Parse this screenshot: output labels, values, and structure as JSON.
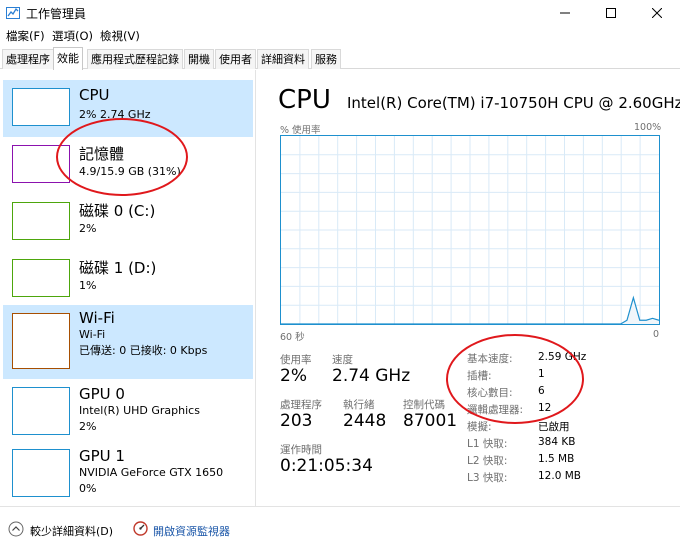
{
  "window": {
    "title": "工作管理員",
    "min_icon": "minimize-icon",
    "max_icon": "maximize-icon",
    "close_icon": "close-icon"
  },
  "menu": [
    {
      "label": "檔案(F)"
    },
    {
      "label": "選項(O)"
    },
    {
      "label": "檢視(V)"
    }
  ],
  "tabs": [
    {
      "label": "處理程序"
    },
    {
      "label": "效能",
      "active": true
    },
    {
      "label": "應用程式歷程記錄"
    },
    {
      "label": "開機"
    },
    {
      "label": "使用者"
    },
    {
      "label": "詳細資料"
    },
    {
      "label": "服務"
    }
  ],
  "sidebar": {
    "items": [
      {
        "title": "CPU",
        "sub1": "2% 2.74 GHz",
        "sub2": "",
        "color": "#1e90ce",
        "selected": true
      },
      {
        "title": "記憶體",
        "sub1": "4.9/15.9 GB (31%)",
        "sub2": "",
        "color": "#8b12ae",
        "selected": false
      },
      {
        "title": "磁碟 0 (C:)",
        "sub1": "2%",
        "sub2": "",
        "color": "#4da60c",
        "selected": false
      },
      {
        "title": "磁碟 1 (D:)",
        "sub1": "1%",
        "sub2": "",
        "color": "#4da60c",
        "selected": false
      },
      {
        "title": "Wi-Fi",
        "sub1": "Wi-Fi",
        "sub2": "已傳送: 0 已接收: 0 Kbps",
        "color": "#a74f01",
        "selected": true
      },
      {
        "title": "GPU 0",
        "sub1": "Intel(R) UHD Graphics",
        "sub2": "2%",
        "color": "#1e90ce",
        "selected": false
      },
      {
        "title": "GPU 1",
        "sub1": "NVIDIA GeForce GTX 1650",
        "sub2": "0%",
        "color": "#1e90ce",
        "selected": false
      }
    ]
  },
  "main": {
    "title": "CPU",
    "model": "Intel(R) Core(TM) i7-10750H CPU @ 2.60GHz",
    "graph": {
      "y_label": "% 使用率",
      "y_max_label": "100%",
      "x_left_label": "60 秒",
      "x_right_label": "0",
      "color": "#1e90ce",
      "usage_history_percent": [
        0,
        0,
        0,
        0,
        0,
        0,
        0,
        0,
        0,
        0,
        0,
        0,
        0,
        0,
        0,
        0,
        0,
        0,
        0,
        0,
        0,
        0,
        0,
        0,
        0,
        0,
        0,
        0,
        0,
        0,
        0,
        0,
        0,
        0,
        0,
        0,
        0,
        0,
        0,
        0,
        0,
        0,
        0,
        0,
        0,
        0,
        0,
        0,
        0,
        0,
        0,
        0,
        0,
        0,
        2,
        14,
        2,
        2,
        3,
        2
      ]
    },
    "stats": {
      "usage_label": "使用率",
      "usage_value": "2%",
      "speed_label": "速度",
      "speed_value": "2.74 GHz",
      "processes_label": "處理程序",
      "processes_value": "203",
      "threads_label": "執行緒",
      "threads_value": "2448",
      "handles_label": "控制代碼",
      "handles_value": "87001",
      "uptime_label": "運作時間",
      "uptime_value": "0:21:05:34"
    },
    "info": [
      {
        "label": "基本速度:",
        "value": "2.59 GHz"
      },
      {
        "label": "插槽:",
        "value": "1"
      },
      {
        "label": "核心數目:",
        "value": "6"
      },
      {
        "label": "邏輯處理器:",
        "value": "12"
      },
      {
        "label": "模擬:",
        "value": "已啟用"
      },
      {
        "label": "L1 快取:",
        "value": "384 KB"
      },
      {
        "label": "L2 快取:",
        "value": "1.5 MB"
      },
      {
        "label": "L3 快取:",
        "value": "12.0 MB"
      }
    ]
  },
  "footer": {
    "less_details": "較少詳細資料(D)",
    "open_monitor": "開啟資源監視器"
  },
  "annotation_color": "#e0181c"
}
